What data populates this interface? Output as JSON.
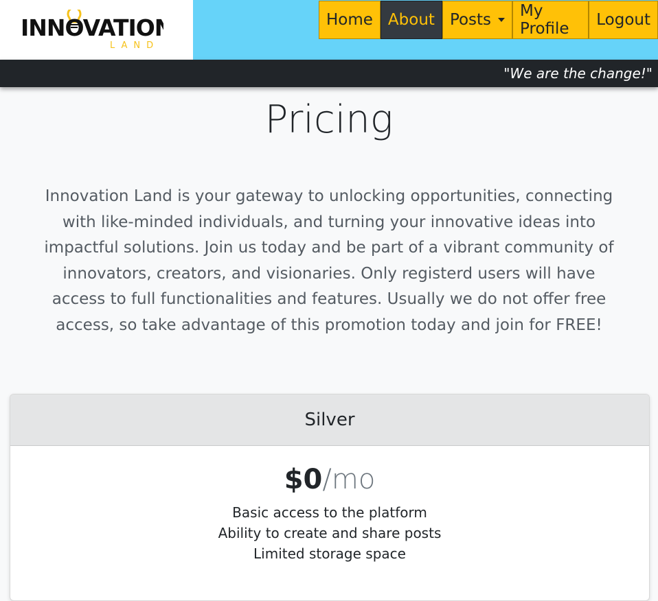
{
  "brand": {
    "logo_top": "INNOVATION",
    "logo_bottom": "LAND"
  },
  "nav": {
    "items": [
      {
        "label": "Home"
      },
      {
        "label": "About"
      },
      {
        "label": "Posts"
      },
      {
        "label": "My Profile"
      },
      {
        "label": "Logout"
      }
    ],
    "active": "About"
  },
  "slogan": "\"We are the change!\"",
  "page": {
    "title": "Pricing",
    "intro": "Innovation Land is your gateway to unlocking opportunities, connecting with like-minded individuals, and turning your innovative ideas into impactful solutions. Join us today and be part of a vibrant community of innovators, creators, and visionaries. Only registerd users will have access to full functionalities and features. Usually we do not offer free access, so take advantage of this promotion today and join for FREE!"
  },
  "plans": [
    {
      "name": "Silver",
      "price": "$0",
      "period": "/mo",
      "features": [
        "Basic access to the platform",
        "Ability to create and share posts",
        "Limited storage space"
      ]
    }
  ],
  "colors": {
    "header_bg": "#66d3f9",
    "nav_bg": "#ffc107",
    "nav_active_bg": "#343a40",
    "slogan_bar_bg": "#212529",
    "logo_accent": "#f6c21b"
  }
}
